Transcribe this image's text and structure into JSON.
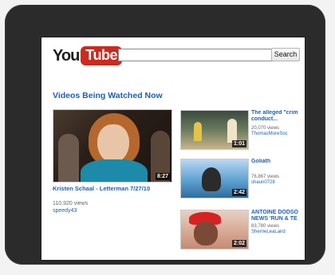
{
  "header": {
    "logo_you": "You",
    "logo_tube": "Tube",
    "search_button": "Search",
    "search_value": ""
  },
  "section_title": "Videos Being Watched Now",
  "featured": {
    "title": "Kristen Schaal - Letterman 7/27/10",
    "views": "110,920 views",
    "user": "speedy43",
    "duration": "8:27"
  },
  "side_videos": [
    {
      "title_line1": "The alleged \"crim",
      "title_line2": "conduct...",
      "views": "20,070 views",
      "user": "ThomasMoreSoc",
      "duration": "1:01"
    },
    {
      "title_line1": "Goliath",
      "title_line2": "",
      "views": "76,867 views",
      "user": "shaun0728",
      "duration": "2:42"
    },
    {
      "title_line1": "ANTOINE DODSO",
      "title_line2": "NEWS 'RUN & TE",
      "views": "83,780 views",
      "user": "SherrieLeaLaird",
      "duration": "2:02"
    }
  ],
  "colors": {
    "link": "#1d5fb7",
    "logo_red": "#cc2a1e",
    "device": "#2b2b2b"
  }
}
